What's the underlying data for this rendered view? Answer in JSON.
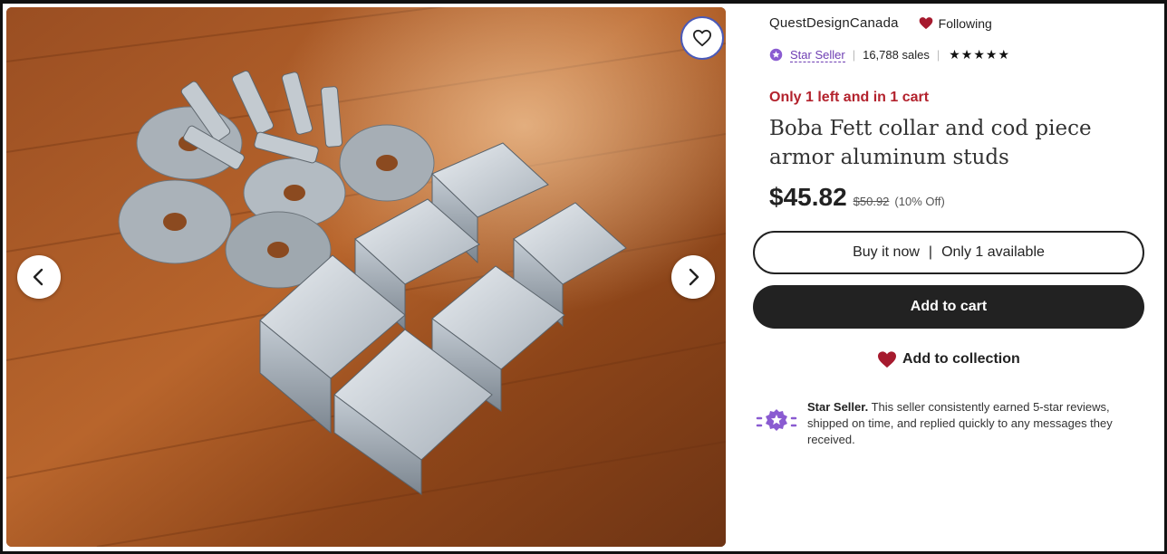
{
  "gallery": {
    "favorite_icon": "heart-outline-icon",
    "prev_icon": "chevron-left-icon",
    "next_icon": "chevron-right-icon"
  },
  "shop": {
    "name": "QuestDesignCanada",
    "following_label": "Following",
    "star_seller_label": "Star Seller",
    "sales": "16,788 sales",
    "rating_stars": 5
  },
  "listing": {
    "urgency": "Only 1 left and in 1 cart",
    "title": "Boba Fett collar and cod piece armor aluminum studs",
    "price": "$45.82",
    "original_price": "$50.92",
    "discount": "(10% Off)"
  },
  "actions": {
    "buy_now": "Buy it now",
    "buy_now_separator": "|",
    "availability": "Only 1 available",
    "add_to_cart": "Add to cart",
    "add_to_collection": "Add to collection"
  },
  "star_seller_info": {
    "heading": "Star Seller.",
    "text": " This seller consistently earned 5-star reviews, shipped on time, and replied quickly to any messages they received."
  },
  "colors": {
    "urgency": "#b3222d",
    "star_seller_purple": "#6f3fb3",
    "heart_red": "#a61a2e",
    "button_dark": "#222222"
  }
}
